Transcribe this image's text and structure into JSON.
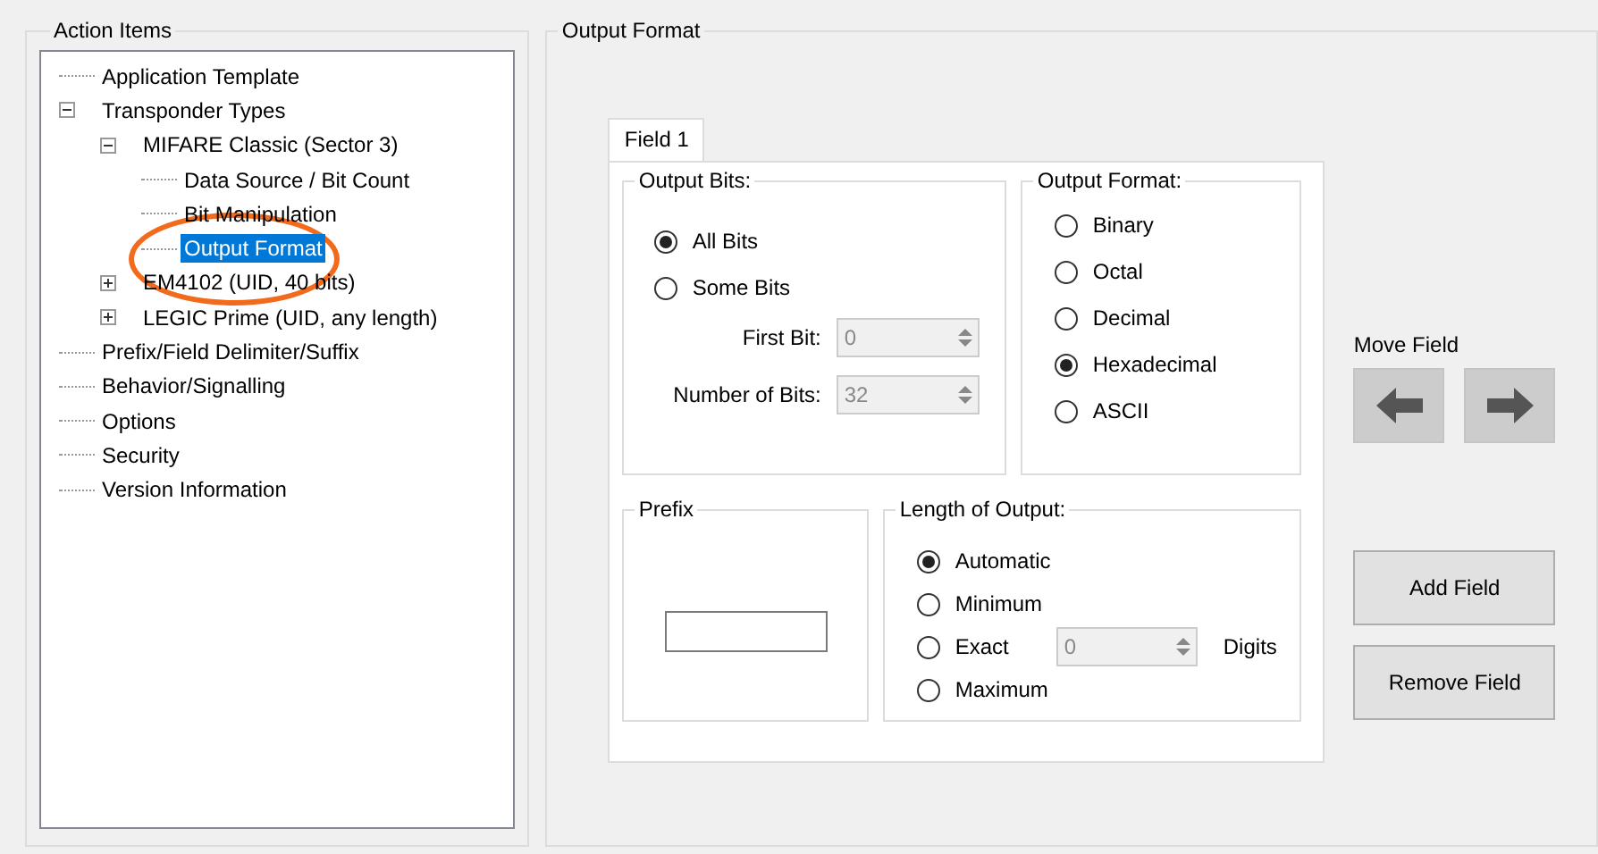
{
  "action_items": {
    "title": "Action Items",
    "tree": [
      {
        "label": "Application Template",
        "selected": false
      },
      {
        "label": "Transponder Types",
        "selected": false,
        "expanded": true,
        "children": [
          {
            "label": "MIFARE Classic (Sector 3)",
            "selected": false,
            "expanded": true,
            "children": [
              {
                "label": "Data Source / Bit Count",
                "selected": false
              },
              {
                "label": "Bit Manipulation",
                "selected": false
              },
              {
                "label": "Output Format",
                "selected": true
              }
            ]
          },
          {
            "label": "EM4102 (UID, 40 bits)",
            "selected": false,
            "expanded": false
          },
          {
            "label": "LEGIC Prime (UID, any length)",
            "selected": false,
            "expanded": false
          }
        ]
      },
      {
        "label": "Prefix/Field Delimiter/Suffix",
        "selected": false
      },
      {
        "label": "Behavior/Signalling",
        "selected": false
      },
      {
        "label": "Options",
        "selected": false
      },
      {
        "label": "Security",
        "selected": false
      },
      {
        "label": "Version Information",
        "selected": false
      }
    ]
  },
  "output_format": {
    "title": "Output Format",
    "tabs": [
      {
        "label": "Field 1",
        "selected": true
      }
    ],
    "output_bits": {
      "title": "Output Bits:",
      "options": [
        {
          "label": "All Bits",
          "selected": true
        },
        {
          "label": "Some Bits",
          "selected": false
        }
      ],
      "spinners": [
        {
          "label": "First Bit:",
          "value": "0",
          "disabled": true
        },
        {
          "label": "Number of Bits:",
          "value": "32",
          "disabled": true
        }
      ]
    },
    "format": {
      "title": "Output Format:",
      "options": [
        {
          "label": "Binary",
          "selected": false
        },
        {
          "label": "Octal",
          "selected": false
        },
        {
          "label": "Decimal",
          "selected": false
        },
        {
          "label": "Hexadecimal",
          "selected": true
        },
        {
          "label": "ASCII",
          "selected": false
        }
      ]
    },
    "prefix": {
      "title": "Prefix"
    },
    "length": {
      "title": "Length of Output:",
      "options": [
        {
          "label": "Automatic",
          "selected": true
        },
        {
          "label": "Minimum",
          "selected": false
        },
        {
          "label": "Exact",
          "selected": false,
          "spinner": {
            "value": "0",
            "disabled": true,
            "unit": "Digits"
          }
        },
        {
          "label": "Maximum",
          "selected": false
        }
      ]
    },
    "move_field": {
      "label": "Move Field",
      "buttons": [
        {
          "kind": "left"
        },
        {
          "kind": "right"
        }
      ]
    },
    "buttons": [
      "Add Field",
      "Remove Field"
    ]
  },
  "annotation": {
    "kind": "ellipse"
  }
}
